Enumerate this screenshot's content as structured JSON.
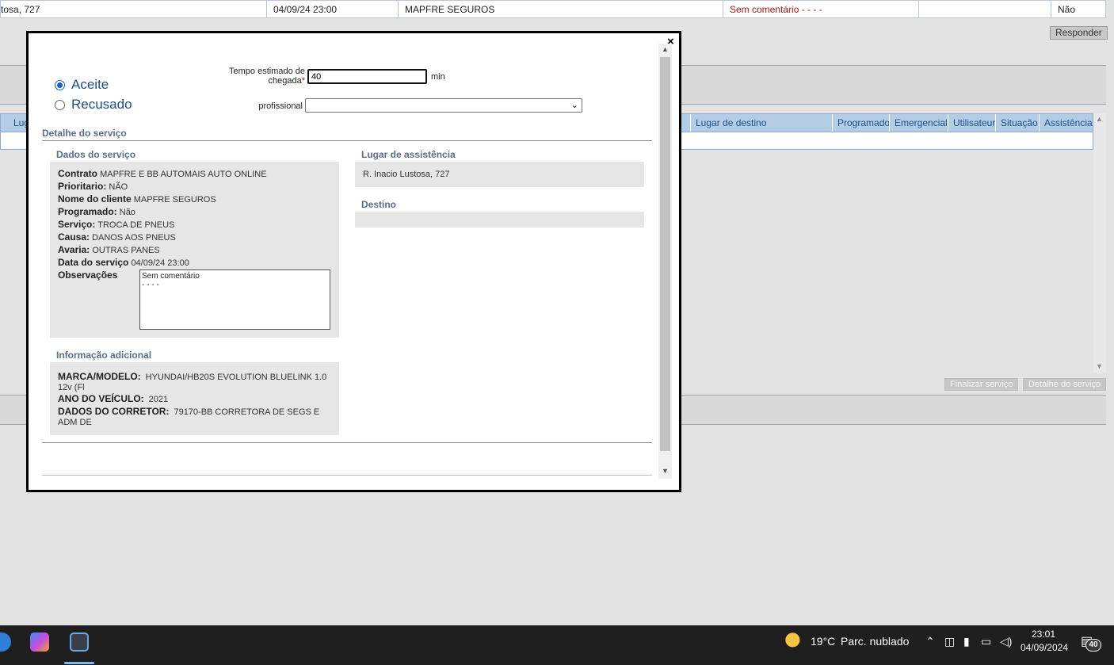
{
  "background": {
    "top_row": {
      "address": "tosa, 727",
      "date": "04/09/24 23:00",
      "client": "MAPFRE SEGUROS",
      "comment": "Sem comentário - - - -",
      "empty": "",
      "flag": "Não"
    },
    "respond_button": "Responder",
    "grid_headers": {
      "lugar_short": "Lug",
      "lugar_destino": "Lugar de destino",
      "programado": "Programado",
      "emergencial": "Emergencial",
      "utilisateur": "Utilisateur",
      "situacao": "Situação",
      "assistencia": "Assistência"
    },
    "finalize_button": "Finalizar serviço",
    "detail_button": "Detalhe do serviço"
  },
  "modal": {
    "close_label": "×",
    "accept_label": "Aceite",
    "accept_selected": true,
    "refuse_label": "Recusado",
    "tempo_label": "Tempo estimado de chegada",
    "tempo_required": "*",
    "tempo_value": "40",
    "tempo_unit": "min",
    "profissional_label": "profissional",
    "profissional_value": "",
    "detail_title": "Detalhe do serviço",
    "dados_title": "Dados do serviço",
    "dados": {
      "contrato_label": "Contrato",
      "contrato_value": "MAPFRE E BB AUTOMAIS AUTO ONLINE",
      "prioritario_label": "Prioritario:",
      "prioritario_value": "NÃO",
      "cliente_label": "Nome do cliente",
      "cliente_value": "MAPFRE SEGUROS",
      "programado_label": "Programado:",
      "programado_value": "Não",
      "servico_label": "Serviço:",
      "servico_value": "TROCA DE PNEUS",
      "causa_label": "Causa:",
      "causa_value": "DANOS AOS PNEUS",
      "avaria_label": "Avaria:",
      "avaria_value": "OUTRAS PANES",
      "data_label": "Data do serviço",
      "data_value": "04/09/24 23:00",
      "obs_label": "Observações",
      "obs_value": "Sem comentário\n- - - -"
    },
    "lugar_title": "Lugar de assistência",
    "lugar_value": "R. Inacio Lustosa, 727",
    "destino_title": "Destino",
    "destino_value": "",
    "info_title": "Informação adicional",
    "info": {
      "marca_label": "MARCA/MODELO:",
      "marca_value": "HYUNDAI/HB20S EVOLUTION BLUELINK 1.0 12v (Fl",
      "ano_label": "ANO DO VEÍCULO:",
      "ano_value": "2021",
      "corretor_label": "DADOS DO CORRETOR:",
      "corretor_value": "79170-BB CORRETORA DE SEGS E ADM DE"
    }
  },
  "taskbar": {
    "weather_temp": "19°C",
    "weather_desc": "Parc. nublado",
    "time": "23:01",
    "date": "04/09/2024",
    "notifications": "40",
    "colors": {
      "bar": "#1f1f1f",
      "accent": "#76b9ed"
    }
  }
}
